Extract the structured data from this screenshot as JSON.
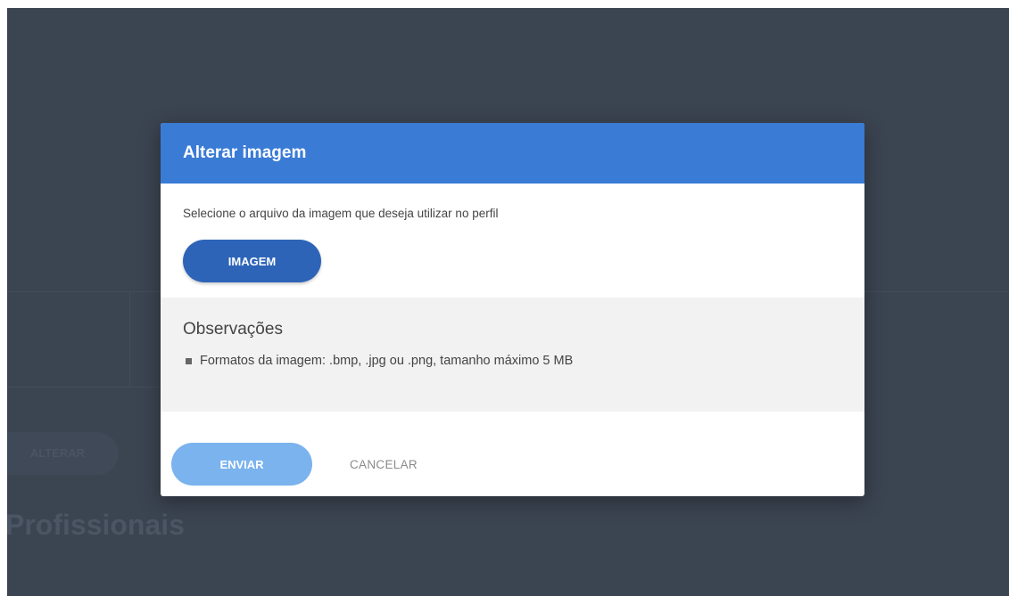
{
  "background": {
    "button_label": "ALTERAR",
    "heading": "Profissionais"
  },
  "modal": {
    "title": "Alterar imagem",
    "instruction": "Selecione o arquivo da imagem que deseja utilizar no perfil",
    "image_button_label": "IMAGEM",
    "notes": {
      "title": "Observações",
      "items": [
        "Formatos da imagem: .bmp, .jpg ou .png, tamanho máximo 5 MB"
      ]
    },
    "submit_label": "ENVIAR",
    "cancel_label": "CANCELAR"
  },
  "colors": {
    "header": "#3a7bd5",
    "primary_button": "#2d64b8",
    "submit_button_disabled": "#7ab3ee",
    "overlay": "#3b4451"
  }
}
